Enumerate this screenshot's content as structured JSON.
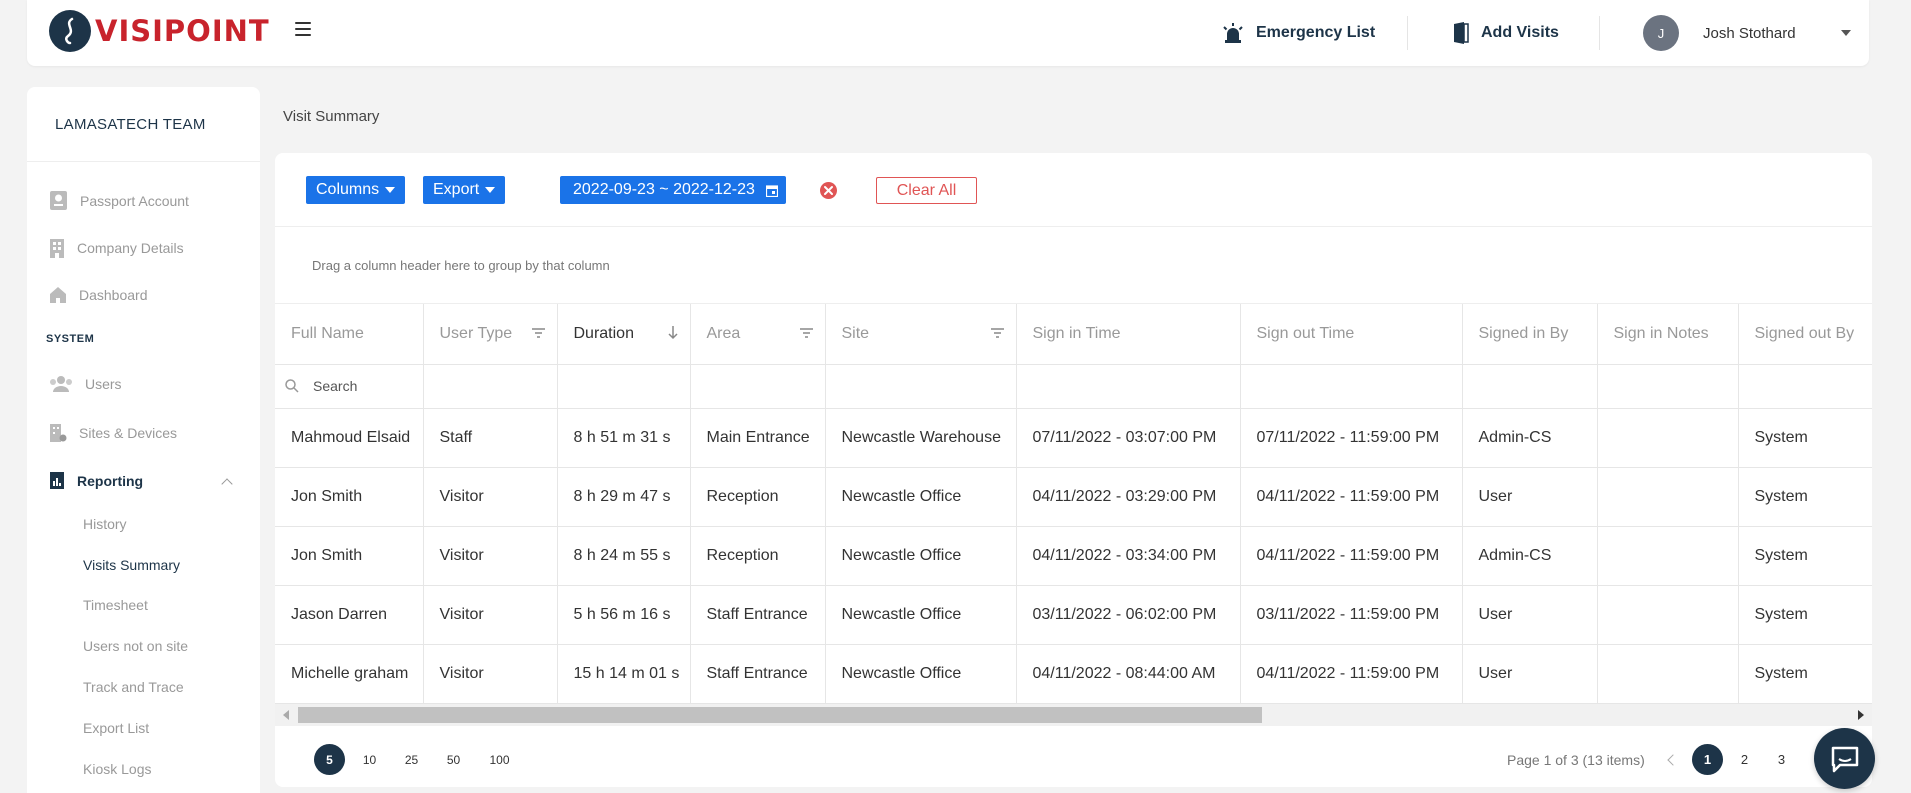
{
  "header": {
    "logo_text": "VISIPOINT",
    "emergency_label": "Emergency List",
    "add_visits_label": "Add Visits",
    "user_initial": "J",
    "user_name": "Josh Stothard"
  },
  "sidebar": {
    "team": "LAMASATECH TEAM",
    "items": [
      {
        "label": "Passport Account"
      },
      {
        "label": "Company Details"
      },
      {
        "label": "Dashboard"
      }
    ],
    "section_system": "SYSTEM",
    "system_items": [
      {
        "label": "Users"
      },
      {
        "label": "Sites & Devices"
      },
      {
        "label": "Reporting"
      }
    ],
    "reporting_sub": [
      {
        "label": "History"
      },
      {
        "label": "Visits Summary"
      },
      {
        "label": "Timesheet"
      },
      {
        "label": "Users not on site"
      },
      {
        "label": "Track and Trace"
      },
      {
        "label": "Export List"
      },
      {
        "label": "Kiosk Logs"
      }
    ]
  },
  "main": {
    "page_title": "Visit Summary",
    "toolbar": {
      "columns_label": "Columns",
      "export_label": "Export",
      "date_range": "2022-09-23 ~ 2022-12-23",
      "clear_all_label": "Clear All"
    },
    "group_hint": "Drag a column header here to group by that column",
    "search_placeholder": "Search",
    "columns": [
      "Full Name",
      "User Type",
      "Duration",
      "Area",
      "Site",
      "Sign in Time",
      "Sign out Time",
      "Signed in By",
      "Sign in Notes",
      "Signed out By"
    ],
    "rows": [
      [
        "Mahmoud Elsaid",
        "Staff",
        "8 h 51 m 31 s",
        "Main Entrance",
        "Newcastle Warehouse",
        "07/11/2022 - 03:07:00 PM",
        "07/11/2022 - 11:59:00 PM",
        "Admin-CS",
        "",
        "System"
      ],
      [
        "Jon Smith",
        "Visitor",
        "8 h 29 m 47 s",
        "Reception",
        "Newcastle Office",
        "04/11/2022 - 03:29:00 PM",
        "04/11/2022 - 11:59:00 PM",
        "User",
        "",
        "System"
      ],
      [
        "Jon Smith",
        "Visitor",
        "8 h 24 m 55 s",
        "Reception",
        "Newcastle Office",
        "04/11/2022 - 03:34:00 PM",
        "04/11/2022 - 11:59:00 PM",
        "Admin-CS",
        "",
        "System"
      ],
      [
        "Jason Darren",
        "Visitor",
        "5 h 56 m 16 s",
        "Staff Entrance",
        "Newcastle Office",
        "03/11/2022 - 06:02:00 PM",
        "03/11/2022 - 11:59:00 PM",
        "User",
        "",
        "System"
      ],
      [
        "Michelle graham",
        "Visitor",
        "15 h 14 m 01 s",
        "Staff Entrance",
        "Newcastle Office",
        "04/11/2022 - 08:44:00 AM",
        "04/11/2022 - 11:59:00 PM",
        "User",
        "",
        "System"
      ]
    ],
    "pager": {
      "sizes": [
        "5",
        "10",
        "25",
        "50",
        "100"
      ],
      "info": "Page 1 of 3 (13 items)",
      "pages": [
        "1",
        "2",
        "3"
      ]
    }
  },
  "colors": {
    "brand_navy": "#1d3448",
    "brand_red": "#c8232c",
    "primary_blue": "#1a73e8",
    "danger": "#e05555"
  }
}
